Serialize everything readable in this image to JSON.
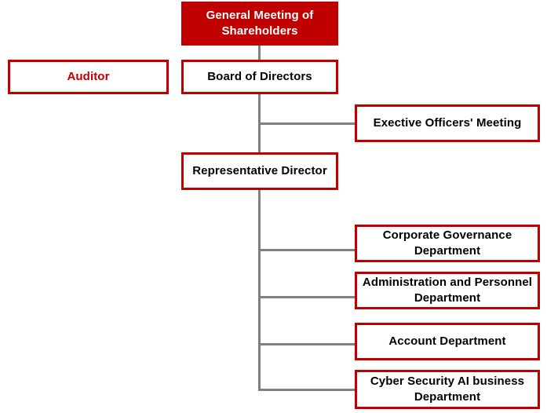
{
  "chart": {
    "type": "org-chart",
    "title": "Corporate Organization Chart",
    "colors": {
      "accent_red": "#C00000",
      "connector_gray": "#808080",
      "background": "#FFFFFF"
    }
  },
  "nodes": {
    "general_meeting": {
      "label": "General Meeting of Shareholders"
    },
    "auditor": {
      "label": "Auditor"
    },
    "board_of_directors": {
      "label": "Board of Directors"
    },
    "executive_officers_meeting": {
      "label": "Exective Officers' Meeting"
    },
    "representative_director": {
      "label": "Representative Director"
    },
    "corporate_governance": {
      "label": "Corporate Governance Department"
    },
    "administration_personnel": {
      "label": "Administration and Personnel Department"
    },
    "account_department": {
      "label": "Account Department"
    },
    "cyber_security": {
      "label": "Cyber Security AI business Department"
    }
  }
}
